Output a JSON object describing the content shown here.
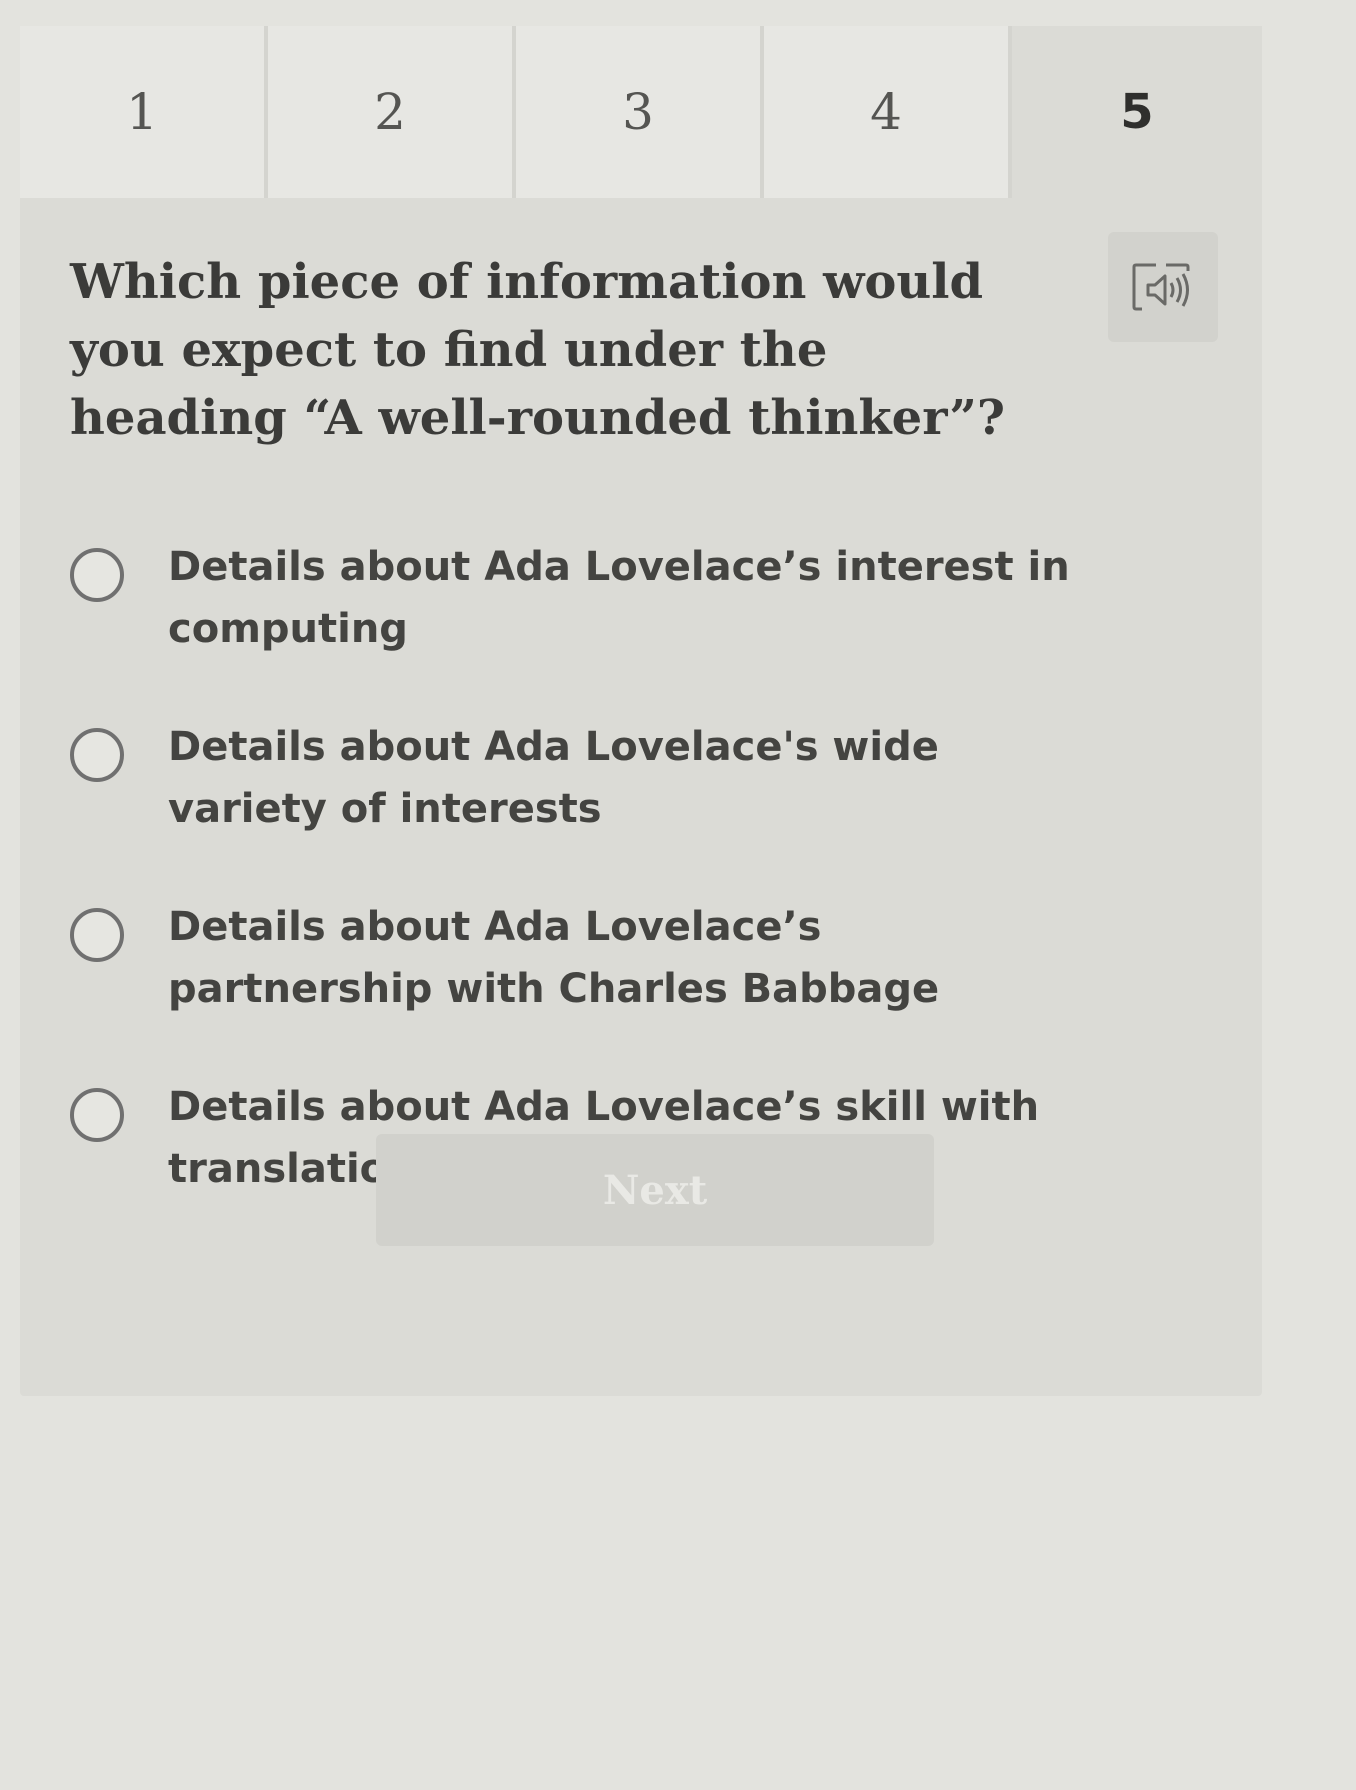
{
  "tabs": [
    {
      "label": "1"
    },
    {
      "label": "2"
    },
    {
      "label": "3"
    },
    {
      "label": "4"
    },
    {
      "label": "5",
      "active": true
    }
  ],
  "question": {
    "text": "Which piece of information would you expect to find under the heading “A well-rounded thinker”?"
  },
  "audio_button": {
    "icon": "speaker-icon"
  },
  "options": [
    {
      "label": "Details about Ada Lovelace’s interest in computing"
    },
    {
      "label": "Details about Ada Lovelace's wide variety of interests"
    },
    {
      "label": "Details about Ada Lovelace’s partnership with Charles Babbage"
    },
    {
      "label": "Details about Ada Lovelace’s skill with translation"
    }
  ],
  "next_button": {
    "label": "Next",
    "disabled": true
  }
}
